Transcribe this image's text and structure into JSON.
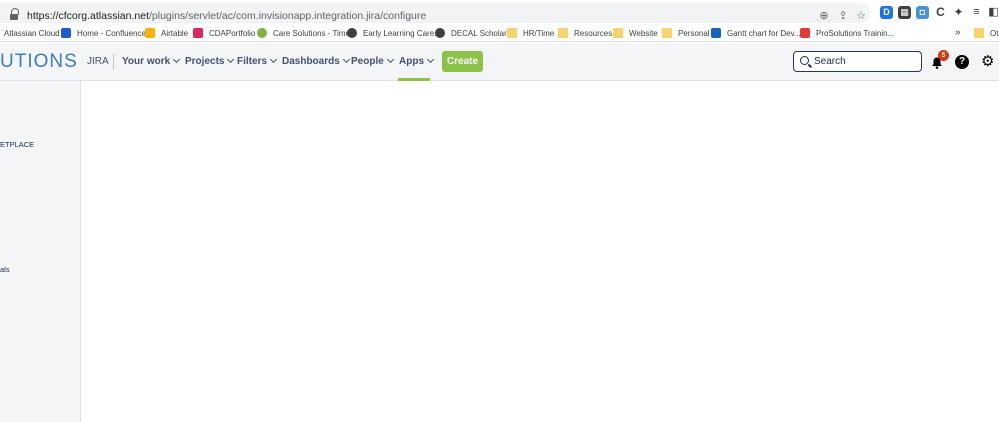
{
  "browser": {
    "url_host": "https://cfcorg.atlassian.net",
    "url_path": "/plugins/servlet/ac/com.invisionapp.integration.jira/configure",
    "bookmarks": [
      {
        "label": "Atlassian Cloud",
        "icon": "none"
      },
      {
        "label": "Home - Confluence",
        "icon": "confluence-icon"
      },
      {
        "label": "Airtable",
        "icon": "airtable-icon"
      },
      {
        "label": "CDAPortfolio",
        "icon": "portfolio-icon"
      },
      {
        "label": "Care Solutions - Time",
        "icon": "care-icon"
      },
      {
        "label": "Early Learning Care...",
        "icon": "globe-icon"
      },
      {
        "label": "DECAL Scholars",
        "icon": "globe-icon"
      },
      {
        "label": "HR/Time",
        "icon": "folder-icon"
      },
      {
        "label": "Resources",
        "icon": "folder-icon"
      },
      {
        "label": "Website",
        "icon": "folder-icon"
      },
      {
        "label": "Personal",
        "icon": "folder-icon"
      },
      {
        "label": "Gantt chart for Dev...",
        "icon": "gantt-icon"
      },
      {
        "label": "ProSolutions Trainin...",
        "icon": "prosolutions-icon"
      }
    ],
    "more_label": "»",
    "other_label": "Oth"
  },
  "jira": {
    "brand": "UTIONS",
    "product": "JIRA",
    "nav": [
      "Your work",
      "Projects",
      "Filters",
      "Dashboards",
      "People",
      "Apps"
    ],
    "create_label": "Create",
    "search_placeholder": "Search",
    "notification_count": "5",
    "help_label": "?",
    "accent": "#8bc34a"
  },
  "sidebar": {
    "marketplace_label": "ETPLACE",
    "item_label": "als"
  }
}
